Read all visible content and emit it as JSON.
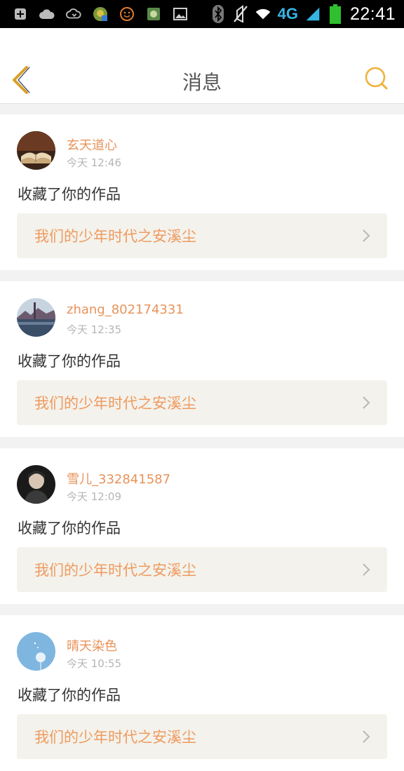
{
  "status_bar": {
    "time": "22:41",
    "network": "4G",
    "left_icons": [
      "add-icon",
      "cloud-icon",
      "cloud-sync-icon",
      "game-app-icon",
      "emoji-app-icon",
      "photo-app-icon",
      "image-icon"
    ],
    "right_icons": [
      "bluetooth-icon",
      "mute-icon",
      "wifi-icon",
      "signal-icon",
      "battery-icon"
    ],
    "accent_color": "#35b5e5"
  },
  "header": {
    "title": "消息",
    "back_icon": "chevron-left-icon",
    "search_icon": "search-icon",
    "accent_color": "#f0b13a"
  },
  "messages": [
    {
      "username": "玄天道心",
      "time": "今天 12:46",
      "action": "收藏了你的作品",
      "work_title": "我们的少年时代之安溪尘",
      "avatar": "book-avatar"
    },
    {
      "username": "zhang_802174331",
      "time": "今天 12:35",
      "action": "收藏了你的作品",
      "work_title": "我们的少年时代之安溪尘",
      "avatar": "landscape-avatar"
    },
    {
      "username": "雪儿_332841587",
      "time": "今天 12:09",
      "action": "收藏了你的作品",
      "work_title": "我们的少年时代之安溪尘",
      "avatar": "portrait-avatar"
    },
    {
      "username": "晴天染色",
      "time": "今天 10:55",
      "action": "收藏了你的作品",
      "work_title": "我们的少年时代之安溪尘",
      "avatar": "dandelion-avatar"
    }
  ],
  "colors": {
    "username": "#e8935a",
    "work_title": "#ef9a5e",
    "work_bg": "#f3f2ec",
    "page_bg": "#f2f2f2"
  }
}
